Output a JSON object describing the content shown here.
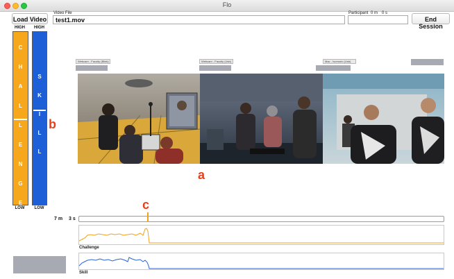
{
  "window": {
    "title": "Flo"
  },
  "toolbar": {
    "load_video_label": "Load Video",
    "video_file_caption": "Video File",
    "video_file_value": "test1.mov",
    "participant_caption": "Participant",
    "time_min": "0 m",
    "time_sec": "0 s",
    "participant_value": "",
    "end_session_label": "End Session"
  },
  "challenge_bar": {
    "high_label": "HIGH",
    "low_label": "LOW",
    "letters": [
      "C",
      "H",
      "A",
      "L",
      "L",
      "E",
      "N",
      "G",
      "E"
    ],
    "level": 0.5,
    "color": "#f7a71b"
  },
  "skill_bar": {
    "high_label": "HIGH",
    "low_label": "LOW",
    "letters": [
      "S",
      "K",
      "I",
      "L",
      "L"
    ],
    "level": 0.55,
    "color": "#1c5fd6"
  },
  "annotations": {
    "a": "a",
    "b": "b",
    "c": "c"
  },
  "camera_dropdowns": [
    "Webcam - Faculty (Blink)",
    "Webcam - Faculty (Usb)",
    "Mac - Isomorio (Usb)"
  ],
  "playback": {
    "minutes": "7 m",
    "seconds": "3 s"
  },
  "graphs": {
    "challenge": {
      "label": "Challenge",
      "color": "#f2a11b"
    },
    "skill": {
      "label": "Skill",
      "color": "#2a62d4"
    }
  }
}
